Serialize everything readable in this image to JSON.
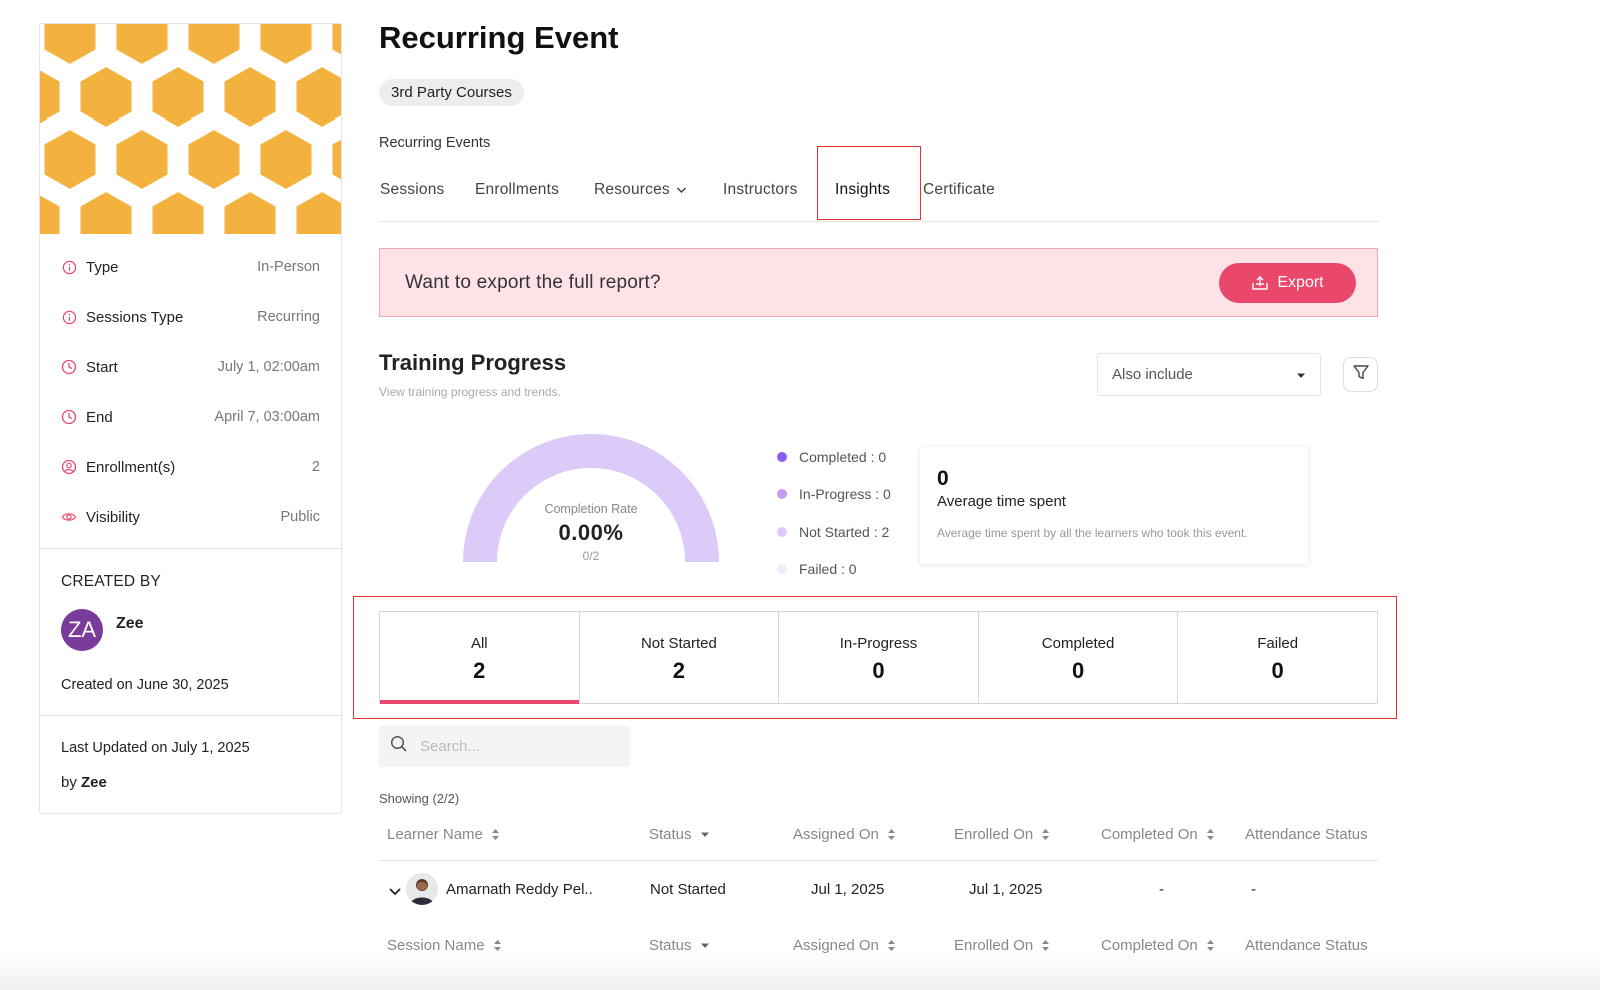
{
  "colors": {
    "accent": "#e9486a",
    "cover": "#f3b23d",
    "highlight": "#e0352b",
    "gauge": "#dccbf8"
  },
  "sidebar": {
    "meta": [
      {
        "icon": "info-icon",
        "label": "Type",
        "value": "In-Person"
      },
      {
        "icon": "info-icon",
        "label": "Sessions Type",
        "value": "Recurring"
      },
      {
        "icon": "clock-icon",
        "label": "Start",
        "value": "July 1, 02:00am"
      },
      {
        "icon": "clock-icon",
        "label": "End",
        "value": "April 7, 03:00am"
      },
      {
        "icon": "user-circle-icon",
        "label": "Enrollment(s)",
        "value": "2"
      },
      {
        "icon": "eye-icon",
        "label": "Visibility",
        "value": "Public"
      }
    ],
    "created_by_header": "CREATED BY",
    "creator_initials": "ZA",
    "creator_name": "Zee",
    "created_on": "Created on June 30, 2025",
    "last_updated": "Last Updated on July 1, 2025",
    "updated_by_prefix": "by",
    "updated_by_name": "Zee"
  },
  "header": {
    "title": "Recurring Event",
    "chip": "3rd Party Courses",
    "breadcrumb": "Recurring Events"
  },
  "tabs": [
    {
      "label": "Sessions"
    },
    {
      "label": "Enrollments"
    },
    {
      "label": "Resources"
    },
    {
      "label": "Instructors"
    },
    {
      "label": "Insights"
    },
    {
      "label": "Certificate"
    }
  ],
  "banner": {
    "text": "Want to export the full report?",
    "button": "Export"
  },
  "training": {
    "title": "Training Progress",
    "subtitle": "View training progress and trends.",
    "also_include": "Also include",
    "completion_label": "Completion Rate",
    "completion_value": "0.00%",
    "completion_count": "0/2",
    "completion_fraction": 0,
    "legend": [
      {
        "label": "Completed : 0",
        "color": "#8b5cf6"
      },
      {
        "label": "In-Progress : 0",
        "color": "#c29bf0"
      },
      {
        "label": "Not Started : 2",
        "color": "#dccbf8"
      },
      {
        "label": "Failed : 0",
        "color": "#f1ecfb"
      }
    ],
    "avg_value": "0",
    "avg_title": "Average time spent",
    "avg_desc": "Average time spent by all the learners who took this event."
  },
  "status_tabs": [
    {
      "label": "All",
      "count": "2"
    },
    {
      "label": "Not Started",
      "count": "2"
    },
    {
      "label": "In-Progress",
      "count": "0"
    },
    {
      "label": "Completed",
      "count": "0"
    },
    {
      "label": "Failed",
      "count": "0"
    }
  ],
  "search": {
    "placeholder": "Search..."
  },
  "showing": "Showing (2/2)",
  "table": {
    "headers": [
      "Learner Name",
      "Status",
      "Assigned On",
      "Enrolled On",
      "Completed On",
      "Attendance Status"
    ],
    "row": {
      "name": "Amarnath Reddy Pel..",
      "status": "Not Started",
      "assigned": "Jul 1, 2025",
      "enrolled": "Jul 1, 2025",
      "completed": "-",
      "attendance": "-"
    },
    "sub_headers": [
      "Session Name",
      "Status",
      "Assigned On",
      "Enrolled On",
      "Completed On",
      "Attendance Status"
    ]
  }
}
